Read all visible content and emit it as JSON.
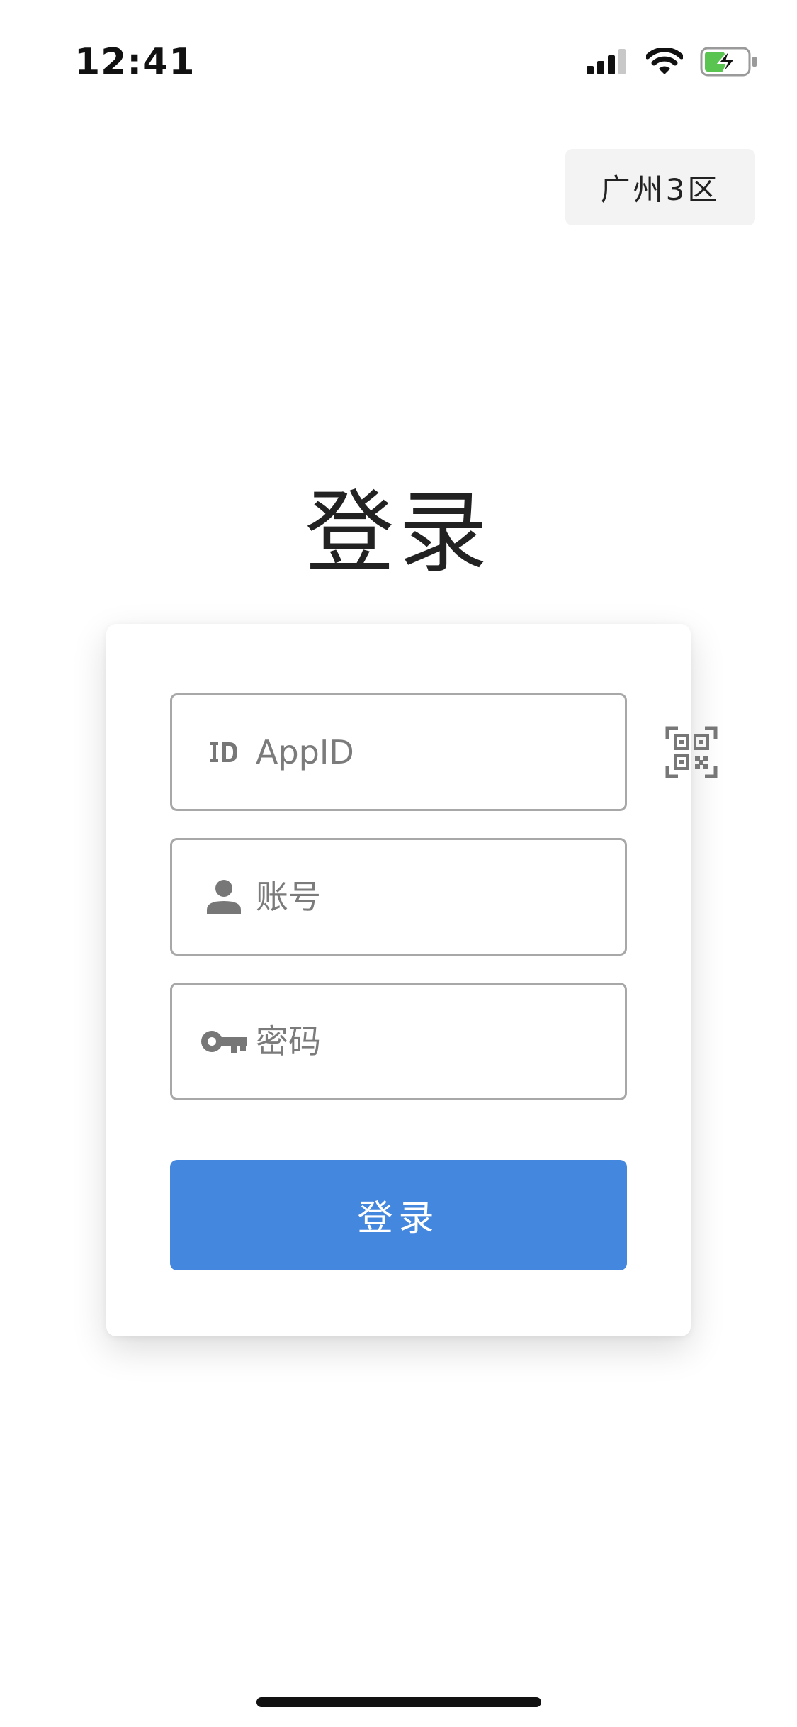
{
  "status_bar": {
    "time": "12:41",
    "icons": [
      "cellular-signal-icon",
      "wifi-icon",
      "battery-charging-icon"
    ]
  },
  "region": {
    "label": "广州3区"
  },
  "title": "登录",
  "form": {
    "appid": {
      "icon": "id-icon",
      "placeholder": "AppID",
      "value": "",
      "action_icon": "qr-code-scan-icon"
    },
    "account": {
      "icon": "person-icon",
      "placeholder": "账号",
      "value": ""
    },
    "password": {
      "icon": "key-icon",
      "placeholder": "密码",
      "value": ""
    },
    "submit_label": "登录"
  },
  "colors": {
    "primary": "#4487de",
    "icon_gray": "#777777",
    "border": "#a8a8a8",
    "region_bg": "#f3f3f3",
    "battery_green": "#5ac451"
  }
}
